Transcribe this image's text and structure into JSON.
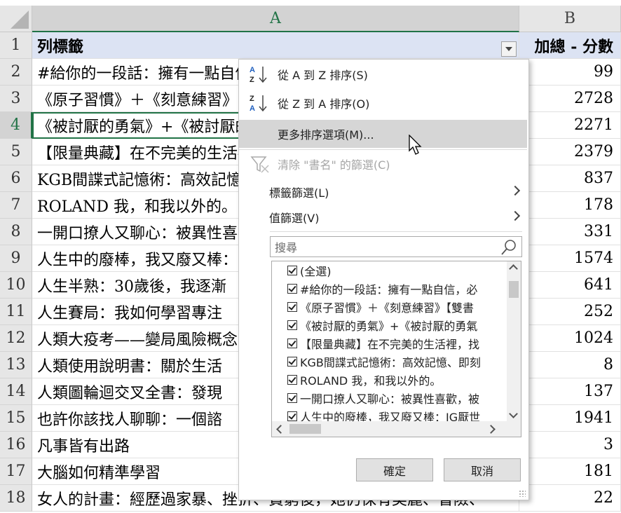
{
  "sheet": {
    "columns": [
      "A",
      "B"
    ],
    "header_row": {
      "num": "1",
      "a": "列標籤",
      "b": "加總 - 分數"
    },
    "rows": [
      {
        "num": "2",
        "a": "#給你的一段話：擁有一點自信，必",
        "b": "99"
      },
      {
        "num": "3",
        "a": "《原子習慣》＋《刻意練習》【雙書",
        "b": "2728"
      },
      {
        "num": "4",
        "a": "《被討厭的勇氣》+《被討厭的勇氣",
        "b": "2271"
      },
      {
        "num": "5",
        "a": "【限量典藏】在不完美的生活裡，找",
        "b": "2379"
      },
      {
        "num": "6",
        "a": "KGB間諜式記憶術：高效記憶、即刻",
        "b": "837"
      },
      {
        "num": "7",
        "a": "ROLAND 我，和我以外的。",
        "b": "178"
      },
      {
        "num": "8",
        "a": "一開口撩人又聊心：被異性喜歡，被",
        "b": "331"
      },
      {
        "num": "9",
        "a": "人生中的廢棒，我又廢又棒：IG厭世",
        "b": "1574"
      },
      {
        "num": "10",
        "a": "人生半熟：30歲後，我逐漸",
        "b": "641"
      },
      {
        "num": "11",
        "a": "人生賽局：我如何學習專注",
        "b": "252"
      },
      {
        "num": "12",
        "a": "人類大疫考——變局風險概念",
        "b": "1024"
      },
      {
        "num": "13",
        "a": "人類使用說明書：關於生活",
        "b": "8"
      },
      {
        "num": "14",
        "a": "人類圖輪迴交叉全書：發現",
        "b": "137"
      },
      {
        "num": "15",
        "a": "也許你該找人聊聊：一個諮",
        "b": "1941"
      },
      {
        "num": "16",
        "a": "凡事皆有出路",
        "b": "3"
      },
      {
        "num": "17",
        "a": "大腦如何精準學習",
        "b": "181"
      },
      {
        "num": "18",
        "a": "女人的計畫：經歷過家暴、挫折、貧窮後，她仍保有美麗、冒險、",
        "b": "22"
      }
    ]
  },
  "menu": {
    "sort_az": "從 A 到 Z 排序(S)",
    "sort_za": "從 Z 到 A 排序(O)",
    "more_sort": "更多排序選項(M)...",
    "clear_filter": "清除 \"書名\" 的篩選(C)",
    "label_filter": "標籤篩選(L)",
    "value_filter": "值篩選(V)",
    "search_placeholder": "搜尋",
    "list": [
      "(全選)",
      "#給你的一段話：擁有一點自信，必",
      "《原子習慣》＋《刻意練習》【雙書",
      "《被討厭的勇氣》+《被討厭的勇氣",
      "【限量典藏】在不完美的生活裡，找",
      "KGB間諜式記憶術：高效記憶、即刻",
      "ROLAND 我，和我以外的。",
      "一開口撩人又聊心：被異性喜歡，被",
      "人生中的廢棒，我又廢又棒：IG厭世"
    ],
    "ok": "確定",
    "cancel": "取消"
  },
  "colors": {
    "header_fill": "#dce3f3",
    "accent": "#217346"
  }
}
